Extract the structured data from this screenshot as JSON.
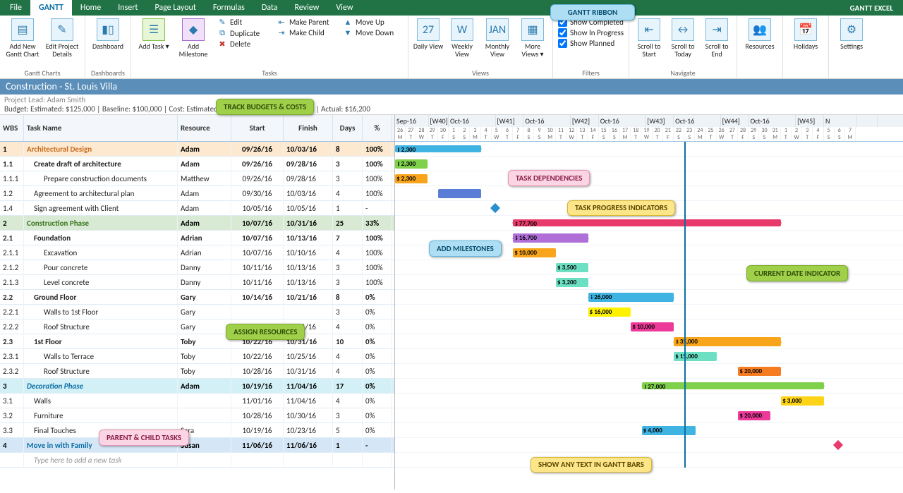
{
  "menu": {
    "tabs": [
      "File",
      "GANTT",
      "Home",
      "Insert",
      "Page Layout",
      "Formulas",
      "Data",
      "Review",
      "View"
    ],
    "active": 1,
    "brand": "GANTT EXCEL"
  },
  "ribbon": {
    "ganttCharts": {
      "label": "Gantt Charts",
      "addNew": "Add New Gantt Chart",
      "editDetails": "Edit Project Details"
    },
    "dashboards": {
      "label": "Dashboards",
      "btn": "Dashboard"
    },
    "tasks": {
      "label": "Tasks",
      "addTask": "Add Task",
      "addMilestone": "Add Milestone",
      "edit": "Edit",
      "duplicate": "Duplicate",
      "delete": "Delete",
      "makeParent": "Make Parent",
      "makeChild": "Make Child",
      "moveUp": "Move Up",
      "moveDown": "Move Down"
    },
    "views": {
      "label": "Views",
      "daily": "Daily View",
      "weekly": "Weekly View",
      "monthly": "Monthly View",
      "more": "More Views"
    },
    "filters": {
      "label": "Filters",
      "completed": "Show Completed",
      "progress": "Show In Progress",
      "planned": "Show Planned"
    },
    "navigate": {
      "label": "Navigate",
      "start": "Scroll to Start",
      "today": "Scroll to Today",
      "end": "Scroll to End"
    },
    "resources": "Resources",
    "holidays": "Holidays",
    "settings": "Settings"
  },
  "project": {
    "title": "Construction - St. Louis Villa",
    "lead": "Project Lead: Adam Smith",
    "budget": "Budget: Estimated: $125,000 | Baseline: $100,000 | Cost: Estimated: $107,000 | Baseline: $17,000 | Actual: $16,200"
  },
  "headers": {
    "wbs": "WBS",
    "task": "Task Name",
    "res": "Resource",
    "start": "Start",
    "finish": "Finish",
    "days": "Days",
    "pct": "%"
  },
  "timeline": {
    "months": [
      {
        "m": "Sep-16",
        "w": "[W40]",
        "span": 5
      },
      {
        "m": "Oct-16",
        "w": "[W41]",
        "span": 7
      },
      {
        "m": "Oct-16",
        "w": "[W42]",
        "span": 7
      },
      {
        "m": "Oct-16",
        "w": "[W43]",
        "span": 7
      },
      {
        "m": "Oct-16",
        "w": "[W44]",
        "span": 7
      },
      {
        "m": "Oct-16",
        "w": "[W45]",
        "span": 7
      },
      {
        "m": "N",
        "w": "",
        "span": 5
      }
    ],
    "days": [
      "26",
      "27",
      "28",
      "29",
      "30",
      "1",
      "2",
      "3",
      "4",
      "5",
      "6",
      "7",
      "8",
      "9",
      "10",
      "11",
      "12",
      "13",
      "14",
      "15",
      "16",
      "17",
      "18",
      "19",
      "20",
      "21",
      "22",
      "23",
      "24",
      "25",
      "26",
      "27",
      "28",
      "29",
      "30",
      "31",
      "1",
      "2",
      "3",
      "4",
      "5",
      "6",
      "7"
    ],
    "dow": [
      "M",
      "T",
      "W",
      "T",
      "F",
      "S",
      "S",
      "M",
      "T",
      "W",
      "T",
      "F",
      "S",
      "S",
      "M",
      "T",
      "W",
      "T",
      "F",
      "S",
      "S",
      "M",
      "T",
      "W",
      "T",
      "F",
      "S",
      "S",
      "M",
      "T",
      "W",
      "T",
      "F",
      "S",
      "S",
      "M",
      "T",
      "W",
      "T",
      "F",
      "S",
      "S",
      "M"
    ],
    "todayCol": 27
  },
  "rows": [
    {
      "wbs": "1",
      "task": "Architectural Design",
      "res": "Adam",
      "start": "09/26/16",
      "fin": "10/03/16",
      "days": "8",
      "pct": "100%",
      "cls": "sum orange",
      "bar": {
        "s": 0,
        "e": 8,
        "c": "#3fb3e2",
        "t": "$ 2,300",
        "arrow": true
      }
    },
    {
      "wbs": "1.1",
      "task": "Create draft of architecture",
      "res": "Adam",
      "start": "09/26/16",
      "fin": "09/28/16",
      "days": "3",
      "pct": "100%",
      "cls": "sub1",
      "ind": 1,
      "bar": {
        "s": 0,
        "e": 3,
        "c": "#7fd04a",
        "t": "$ 2,300",
        "arrow": true
      }
    },
    {
      "wbs": "1.1.1",
      "task": "Prepare construction documents",
      "res": "Matthew",
      "start": "09/26/16",
      "fin": "09/28/16",
      "days": "3",
      "pct": "100%",
      "cls": "",
      "ind": 2,
      "bar": {
        "s": 0,
        "e": 3,
        "c": "#f9a51b",
        "t": "$ 2,300"
      }
    },
    {
      "wbs": "1.2",
      "task": "Agreement to architectural plan",
      "res": "Adam",
      "start": "09/30/16",
      "fin": "10/03/16",
      "days": "4",
      "pct": "100%",
      "cls": "",
      "ind": 1,
      "bar": {
        "s": 4,
        "e": 8,
        "c": "#5b7dd6",
        "t": ""
      }
    },
    {
      "wbs": "1.4",
      "task": "Sign agreement with Client",
      "res": "Adam",
      "start": "10/05/16",
      "fin": "10/05/16",
      "days": "1",
      "pct": "-",
      "cls": "",
      "ind": 1,
      "dia": {
        "s": 9,
        "c": "#2a8fd0"
      }
    },
    {
      "wbs": "2",
      "task": "Construction Phase",
      "res": "Adam",
      "start": "10/07/16",
      "fin": "10/31/16",
      "days": "25",
      "pct": "33%",
      "cls": "sum green",
      "bar": {
        "s": 11,
        "e": 36,
        "c": "#e83a6b",
        "t": "$ 77,700",
        "arrow": true
      }
    },
    {
      "wbs": "2.1",
      "task": "Foundation",
      "res": "Adrian",
      "start": "10/07/16",
      "fin": "10/13/16",
      "days": "7",
      "pct": "100%",
      "cls": "sub1",
      "ind": 1,
      "bar": {
        "s": 11,
        "e": 18,
        "c": "#b06fd8",
        "t": "$ 16,700",
        "arrow": true
      }
    },
    {
      "wbs": "2.1.1",
      "task": "Excavation",
      "res": "Adrian",
      "start": "10/07/16",
      "fin": "10/10/16",
      "days": "4",
      "pct": "100%",
      "cls": "",
      "ind": 2,
      "bar": {
        "s": 11,
        "e": 15,
        "c": "#f9a51b",
        "t": "$ 10,000"
      }
    },
    {
      "wbs": "2.1.2",
      "task": "Pour concrete",
      "res": "Danny",
      "start": "10/11/16",
      "fin": "10/13/16",
      "days": "3",
      "pct": "100%",
      "cls": "",
      "ind": 2,
      "bar": {
        "s": 15,
        "e": 18,
        "c": "#6de0c4",
        "t": "$ 3,500"
      }
    },
    {
      "wbs": "2.1.3",
      "task": "Level concrete",
      "res": "Danny",
      "start": "10/11/16",
      "fin": "10/13/16",
      "days": "3",
      "pct": "100%",
      "cls": "",
      "ind": 2,
      "bar": {
        "s": 15,
        "e": 18,
        "c": "#6de0c4",
        "t": "$ 3,200"
      }
    },
    {
      "wbs": "2.2",
      "task": "Ground Floor",
      "res": "Gary",
      "start": "10/14/16",
      "fin": "10/21/16",
      "days": "8",
      "pct": "0%",
      "cls": "sub1",
      "ind": 1,
      "bar": {
        "s": 18,
        "e": 26,
        "c": "#3fb3e2",
        "t": "$ 26,000",
        "arrow": true
      }
    },
    {
      "wbs": "2.2.1",
      "task": "Walls to 1st Floor",
      "res": "Gary",
      "start": "",
      "fin": "",
      "days": "3",
      "pct": "0%",
      "cls": "",
      "ind": 2,
      "bar": {
        "s": 18,
        "e": 22,
        "c": "#fff200",
        "t": "$ 16,000"
      }
    },
    {
      "wbs": "2.2.2",
      "task": "Roof Structure",
      "res": "Gary",
      "start": "10/18/16",
      "fin": "10/21/16",
      "days": "4",
      "pct": "0%",
      "cls": "",
      "ind": 2,
      "bar": {
        "s": 22,
        "e": 26,
        "c": "#ed3a9a",
        "t": "$ 10,000"
      }
    },
    {
      "wbs": "2.3",
      "task": "1st Floor",
      "res": "Toby",
      "start": "10/22/16",
      "fin": "10/31/16",
      "days": "10",
      "pct": "0%",
      "cls": "sub1",
      "ind": 1,
      "bar": {
        "s": 26,
        "e": 36,
        "c": "#f9a51b",
        "t": "$ 35,000",
        "arrow": true
      }
    },
    {
      "wbs": "2.3.1",
      "task": "Walls to Terrace",
      "res": "Toby",
      "start": "10/22/16",
      "fin": "10/25/16",
      "days": "4",
      "pct": "0%",
      "cls": "",
      "ind": 2,
      "bar": {
        "s": 26,
        "e": 30,
        "c": "#6de0c4",
        "t": "$ 15,000"
      }
    },
    {
      "wbs": "2.3.2",
      "task": "Roof Structure",
      "res": "Toby",
      "start": "10/28/16",
      "fin": "10/31/16",
      "days": "4",
      "pct": "0%",
      "cls": "",
      "ind": 2,
      "bar": {
        "s": 32,
        "e": 36,
        "c": "#f57c20",
        "t": "$ 20,000"
      }
    },
    {
      "wbs": "3",
      "task": "Decoration Phase",
      "res": "Adam",
      "start": "10/19/16",
      "fin": "11/04/16",
      "days": "17",
      "pct": "0%",
      "cls": "sum cyan",
      "bar": {
        "s": 23,
        "e": 40,
        "c": "#7fd04a",
        "t": "$ 27,000",
        "arrow": true
      }
    },
    {
      "wbs": "3.1",
      "task": "Walls",
      "res": "",
      "start": "11/01/16",
      "fin": "11/04/16",
      "days": "4",
      "pct": "0%",
      "cls": "",
      "ind": 1,
      "bar": {
        "s": 36,
        "e": 40,
        "c": "#fcd316",
        "t": "$ 3,000"
      }
    },
    {
      "wbs": "3.2",
      "task": "Furniture",
      "res": "",
      "start": "10/28/16",
      "fin": "10/30/16",
      "days": "3",
      "pct": "0%",
      "cls": "",
      "ind": 1,
      "bar": {
        "s": 32,
        "e": 35,
        "c": "#ed3a9a",
        "t": "$ 20,000"
      }
    },
    {
      "wbs": "3.3",
      "task": "Final Touches",
      "res": "Sara",
      "start": "10/19/16",
      "fin": "10/23/16",
      "days": "5",
      "pct": "0%",
      "cls": "",
      "ind": 1,
      "bar": {
        "s": 23,
        "e": 28,
        "c": "#3fb3e2",
        "t": "$ 4,000"
      }
    },
    {
      "wbs": "4",
      "task": "Move in with Family",
      "res": "Susan",
      "start": "11/06/16",
      "fin": "11/06/16",
      "days": "1",
      "pct": "-",
      "cls": "sum blue",
      "dia": {
        "s": 41,
        "c": "#e83a6b"
      }
    },
    {
      "wbs": "",
      "task": "Type here to add a new task",
      "res": "",
      "start": "",
      "fin": "",
      "days": "",
      "pct": "",
      "cls": "placeholder",
      "ind": 1
    }
  ],
  "callouts": {
    "ribbon": "GANTT RIBBON",
    "budgets": "TRACK BUDGETS & COSTS",
    "dependencies": "TASK DEPENDENCIES",
    "progress": "TASK PROGRESS INDICATORS",
    "milestones": "ADD MILESTONES",
    "current": "CURRENT DATE INDICATOR",
    "resources": "ASSIGN RESOURCES",
    "parentchild": "PARENT & CHILD TASKS",
    "bartext": "SHOW ANY TEXT IN GANTT BARS"
  }
}
